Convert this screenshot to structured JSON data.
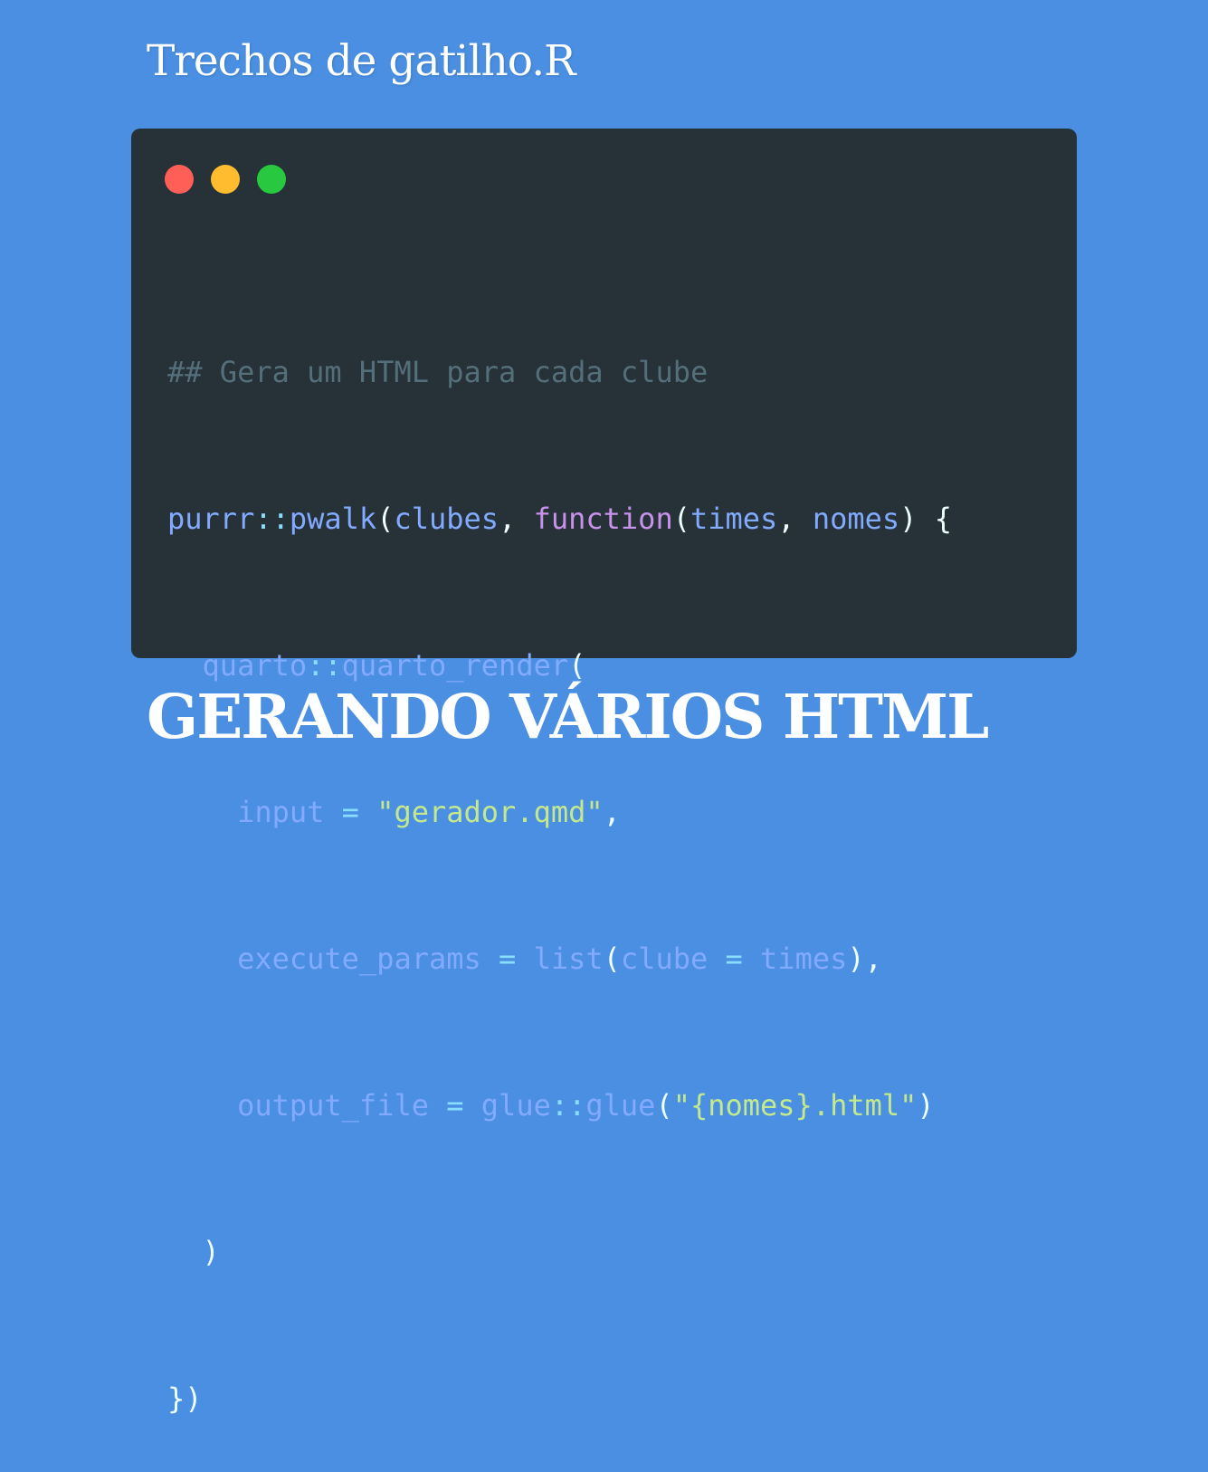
{
  "title": "Trechos de gatilho.R",
  "window_dots": [
    {
      "name": "close",
      "color": "#ff5f57"
    },
    {
      "name": "minimize",
      "color": "#febc2e"
    },
    {
      "name": "maximize",
      "color": "#28c840"
    }
  ],
  "theme_colors": {
    "background": "#4a8fe2",
    "code_background": "#263238",
    "comment": "#546e7a",
    "function": "#82aaff",
    "keyword": "#c792ea",
    "string": "#c3e88d",
    "operator": "#89ddff",
    "punctuation": "#eeffff"
  },
  "code": {
    "lines": [
      "## Gera um HTML para cada clube",
      "purrr::pwalk(clubes, function(times, nomes) {",
      "  quarto::quarto_render(",
      "    input = \"gerador.qmd\",",
      "    execute_params = list(clube = times),",
      "    output_file = glue::glue(\"{nomes}.html\")",
      "  )",
      "})"
    ]
  },
  "footer_title": "GERANDO VÁRIOS HTML"
}
